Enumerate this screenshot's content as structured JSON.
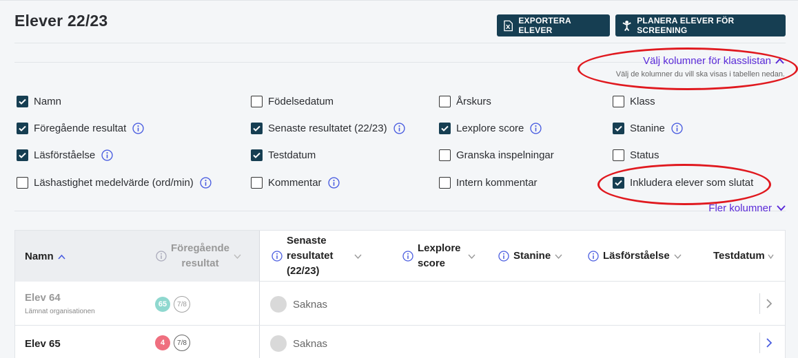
{
  "page": {
    "title": "Elever 22/23"
  },
  "toolbar": {
    "export_label": "EXPORTERA ELEVER",
    "plan_label": "PLANERA ELEVER FÖR SCREENING"
  },
  "columns_panel": {
    "toggle_label": "Välj kolumner för klasslistan",
    "hint": "Välj de kolumner du vill ska visas i tabellen nedan.",
    "more_label": "Fler kolumner",
    "options": [
      {
        "label": "Namn",
        "checked": true,
        "info": false
      },
      {
        "label": "Födelsedatum",
        "checked": false,
        "info": false
      },
      {
        "label": "Årskurs",
        "checked": false,
        "info": false
      },
      {
        "label": "Klass",
        "checked": false,
        "info": false
      },
      {
        "label": "Föregående resultat",
        "checked": true,
        "info": true
      },
      {
        "label": "Senaste resultatet (22/23)",
        "checked": true,
        "info": true
      },
      {
        "label": "Lexplore score",
        "checked": true,
        "info": true
      },
      {
        "label": "Stanine",
        "checked": true,
        "info": true
      },
      {
        "label": "Läsförståelse",
        "checked": true,
        "info": true
      },
      {
        "label": "Testdatum",
        "checked": true,
        "info": false
      },
      {
        "label": "Granska inspelningar",
        "checked": false,
        "info": false
      },
      {
        "label": "Status",
        "checked": false,
        "info": false
      },
      {
        "label": "Läshastighet medelvärde (ord/min)",
        "checked": false,
        "info": true
      },
      {
        "label": "Kommentar",
        "checked": false,
        "info": true
      },
      {
        "label": "Intern kommentar",
        "checked": false,
        "info": false
      },
      {
        "label": "Inkludera elever som slutat",
        "checked": true,
        "info": false
      }
    ]
  },
  "table": {
    "headers": {
      "name": "Namn",
      "previous_line1": "Föregående",
      "previous_line2": "resultat",
      "latest_line1": "Senaste",
      "latest_line2": "resultatet",
      "latest_line3": "(22/23)",
      "lexplore_line1": "Lexplore",
      "lexplore_line2": "score",
      "stanine": "Stanine",
      "comprehension": "Läsförståelse",
      "test_date": "Testdatum"
    },
    "rows": [
      {
        "name": "Elev 64",
        "subtitle": "Lämnat organisationen",
        "score": "65",
        "score_color": "#8fd8cf",
        "ratio": "7/8",
        "latest": "Saknas"
      },
      {
        "name": "Elev 65",
        "subtitle": "",
        "score": "4",
        "score_color": "#ef6f7f",
        "ratio": "7/8",
        "latest": "Saknas"
      }
    ]
  },
  "colors": {
    "primary": "#163e52",
    "accent": "#5b2bd9",
    "highlight": "#e0191f",
    "info": "#4a5de0"
  }
}
